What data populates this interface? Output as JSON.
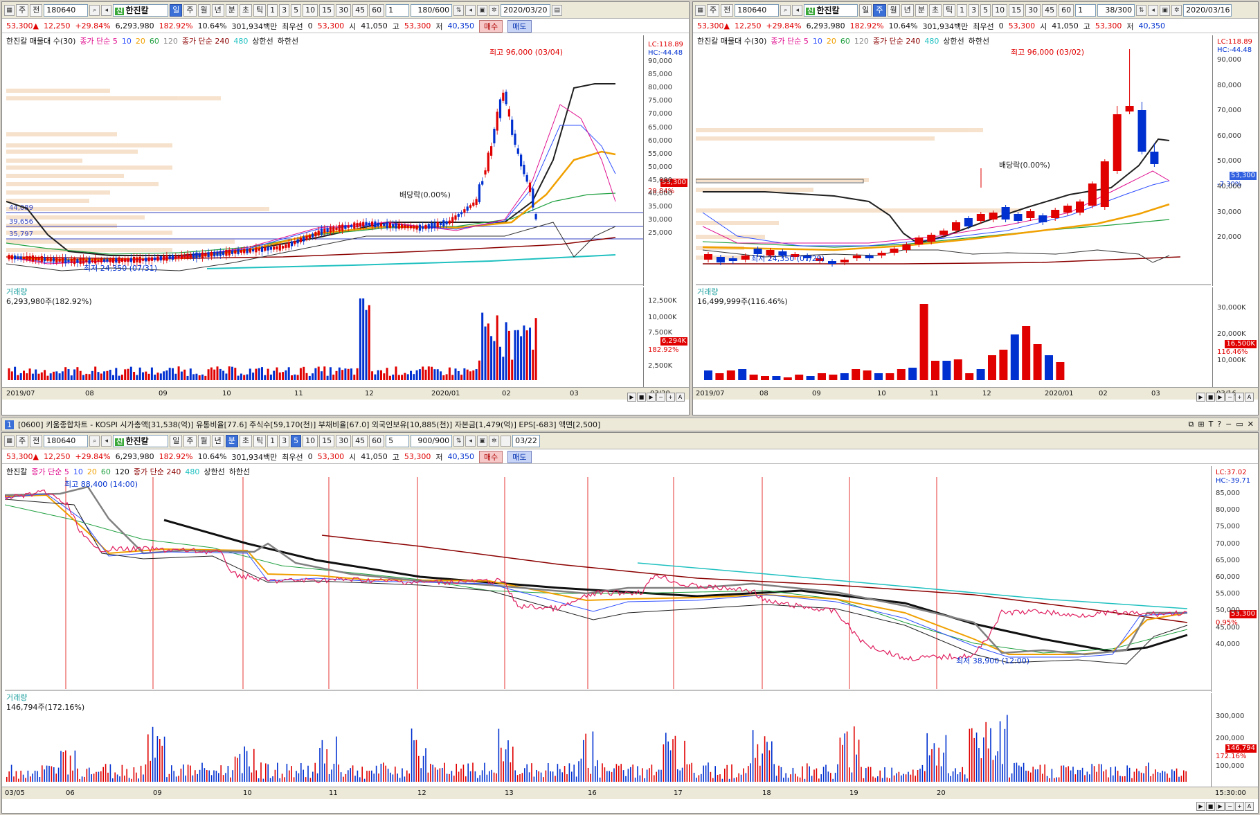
{
  "panes": {
    "topleft": {
      "toolbar": {
        "market": "주",
        "prev": "전",
        "code": "180640",
        "name_badge": "신",
        "name": "한진칼",
        "periods": [
          "일",
          "주",
          "월",
          "년",
          "분",
          "초",
          "틱"
        ],
        "active_period": "일",
        "nums": [
          "1",
          "3",
          "5",
          "10",
          "15",
          "30",
          "45",
          "60"
        ],
        "unit": "1",
        "count": "180/600",
        "date": "2020/03/20"
      },
      "quote": {
        "price": "53,300",
        "change": "12,250",
        "rate": "+29.84%",
        "volume": "6,293,980",
        "turnover": "182.92%",
        "ratio": "10.64%",
        "amount": "301,934백만",
        "bid_label": "최우선",
        "bid": "0",
        "cur": "53,300",
        "open_lbl": "시",
        "open": "41,050",
        "high_lbl": "고",
        "high": "53,300",
        "low_lbl": "저",
        "low": "40,350",
        "buy": "매수",
        "sell": "매도"
      },
      "legend": {
        "name": "한진칼 매물대 수(30)",
        "ma_lbl": "종가 단순 5",
        "ma10": "10",
        "ma20": "20",
        "ma60": "60",
        "ma120": "120",
        "ma240": "종가 단순 240",
        "ma480": "480",
        "upper": "상한선",
        "lower": "하한선"
      },
      "lc": "LC:118.89",
      "hc": "HC:-44.48",
      "annot_high": "최고 96,000 (03/04)",
      "annot_low": "최저 24,350 (07/31)",
      "annot_div": "배당락(0.00%)",
      "levels": [
        "44,089",
        "39,656",
        "35,797"
      ],
      "yaxis": [
        "90,000",
        "85,000",
        "80,000",
        "75,000",
        "70,000",
        "65,000",
        "60,000",
        "55,000",
        "50,000",
        "45,000",
        "40,000",
        "35,000",
        "30,000",
        "25,000"
      ],
      "price_tag": "53,300",
      "rate_tag": "29.84%",
      "vol_title": "거래량",
      "vol_info": "6,293,980주(182.92%)",
      "vol_axis": [
        "12,500K",
        "10,000K",
        "7,500K",
        "5,000K",
        "2,500K"
      ],
      "vol_tag": "6,294K",
      "vol_rate": "182.92%",
      "xaxis": [
        "2019/07",
        "08",
        "09",
        "10",
        "11",
        "12",
        "2020/01",
        "02",
        "03",
        "03/20"
      ]
    },
    "topright": {
      "toolbar": {
        "market": "주",
        "prev": "전",
        "code": "180640",
        "name_badge": "신",
        "name": "한진칼",
        "periods": [
          "일",
          "주",
          "월",
          "년",
          "분",
          "초",
          "틱"
        ],
        "active_period": "주",
        "nums": [
          "1",
          "3",
          "5",
          "10",
          "15",
          "30",
          "45",
          "60"
        ],
        "unit": "1",
        "count": "38/300",
        "date": "2020/03/16"
      },
      "quote": {
        "price": "53,300",
        "change": "12,250",
        "rate": "+29.84%",
        "volume": "6,293,980",
        "turnover": "182.92%",
        "ratio": "10.64%",
        "amount": "301,934백만",
        "bid_label": "최우선",
        "bid": "0",
        "cur": "53,300",
        "open_lbl": "시",
        "open": "41,050",
        "high_lbl": "고",
        "high": "53,300",
        "low_lbl": "저",
        "low": "40,350"
      },
      "legend": {
        "name": "한진칼 매물대 수(30)",
        "ma_lbl": "종가 단순 5",
        "ma10": "10",
        "ma20": "20",
        "ma60": "60",
        "ma120": "120",
        "ma240": "종가 단순 240",
        "ma480": "480",
        "upper": "상한선",
        "lower": "하한선"
      },
      "lc": "LC:118.89",
      "hc": "HC:-44.48",
      "annot_high": "최고 96,000 (03/02)",
      "annot_low": "최저 24,350 (07/29)",
      "annot_div": "배당락(0.00%)",
      "yaxis": [
        "90,000",
        "80,000",
        "70,000",
        "60,000",
        "50,000",
        "40,000",
        "30,000",
        "20,000"
      ],
      "price_tag": "53,300",
      "rate_tag": "-7.30%",
      "vol_title": "거래량",
      "vol_info": "16,499,999주(116.46%)",
      "vol_axis": [
        "30,000K",
        "20,000K",
        "10,000K"
      ],
      "vol_tag": "16,500K",
      "vol_rate": "116.46%",
      "xaxis": [
        "2019/07",
        "08",
        "09",
        "10",
        "11",
        "12",
        "2020/01",
        "02",
        "03",
        "03/16"
      ]
    },
    "bottom": {
      "header": {
        "num": "1",
        "text": "[0600] 키움종합차트 - KOSPI 시가총액[31,538(억)] 유통비율[77.6] 주식수[59,170(천)] 부채비율[67.0] 외국인보유[10,885(천)] 자본금[1,479(억)] EPS[-683] 액면[2,500]"
      },
      "toolbar": {
        "market": "주",
        "prev": "전",
        "code": "180640",
        "name_badge": "신",
        "name": "한진칼",
        "periods": [
          "일",
          "주",
          "월",
          "년",
          "분",
          "초",
          "틱"
        ],
        "active_period": "분",
        "nums": [
          "1",
          "3",
          "5",
          "10",
          "15",
          "30",
          "45",
          "60"
        ],
        "active_num": "5",
        "unit": "5",
        "count": "900/900",
        "date": "03/22"
      },
      "quote": {
        "price": "53,300",
        "change": "12,250",
        "rate": "+29.84%",
        "volume": "6,293,980",
        "turnover": "182.92%",
        "ratio": "10.64%",
        "amount": "301,934백만",
        "bid_label": "최우선",
        "bid": "0",
        "cur": "53,300",
        "open_lbl": "시",
        "open": "41,050",
        "high_lbl": "고",
        "high": "53,300",
        "low_lbl": "저",
        "low": "40,350",
        "buy": "매수",
        "sell": "매도"
      },
      "legend": {
        "name": "한진칼",
        "ma_lbl": "종가 단순 5",
        "ma10": "10",
        "ma20": "20",
        "ma60": "60",
        "ma120": "120",
        "ma240": "종가 단순 240",
        "ma480": "480",
        "upper": "상한선",
        "lower": "하한선"
      },
      "lc": "LC:37.02",
      "hc": "HC:-39.71",
      "annot_high": "최고 88,400 (14:00)",
      "annot_low": "최저 38,900 (12:00)",
      "yaxis": [
        "85,000",
        "80,000",
        "75,000",
        "70,000",
        "65,000",
        "60,000",
        "55,000",
        "50,000",
        "45,000",
        "40,000"
      ],
      "price_tag": "53,300",
      "rate_tag": "0.95%",
      "vol_title": "거래량",
      "vol_info": "146,794주(172.16%)",
      "vol_axis": [
        "300,000",
        "200,000",
        "100,000"
      ],
      "vol_tag": "146,794",
      "vol_rate": "172.16%",
      "xaxis": [
        "03/05",
        "06",
        "09",
        "10",
        "11",
        "12",
        "13",
        "16",
        "17",
        "18",
        "19",
        "20",
        "15:30:00"
      ]
    }
  },
  "colors": {
    "up": "#e00000",
    "down": "#0030d0",
    "ma5": "#e01090",
    "ma10": "#3050ff",
    "ma20": "#f0a000",
    "ma60": "#20a040",
    "ma120": "#202020",
    "ma240": "#8b0000",
    "ma480": "#20c0c0"
  },
  "icons": [
    "search-icon",
    "speaker-icon",
    "grid-icon",
    "save-icon",
    "gear-icon",
    "play-icon",
    "stop-icon",
    "zoom-in-icon",
    "zoom-out-icon"
  ]
}
